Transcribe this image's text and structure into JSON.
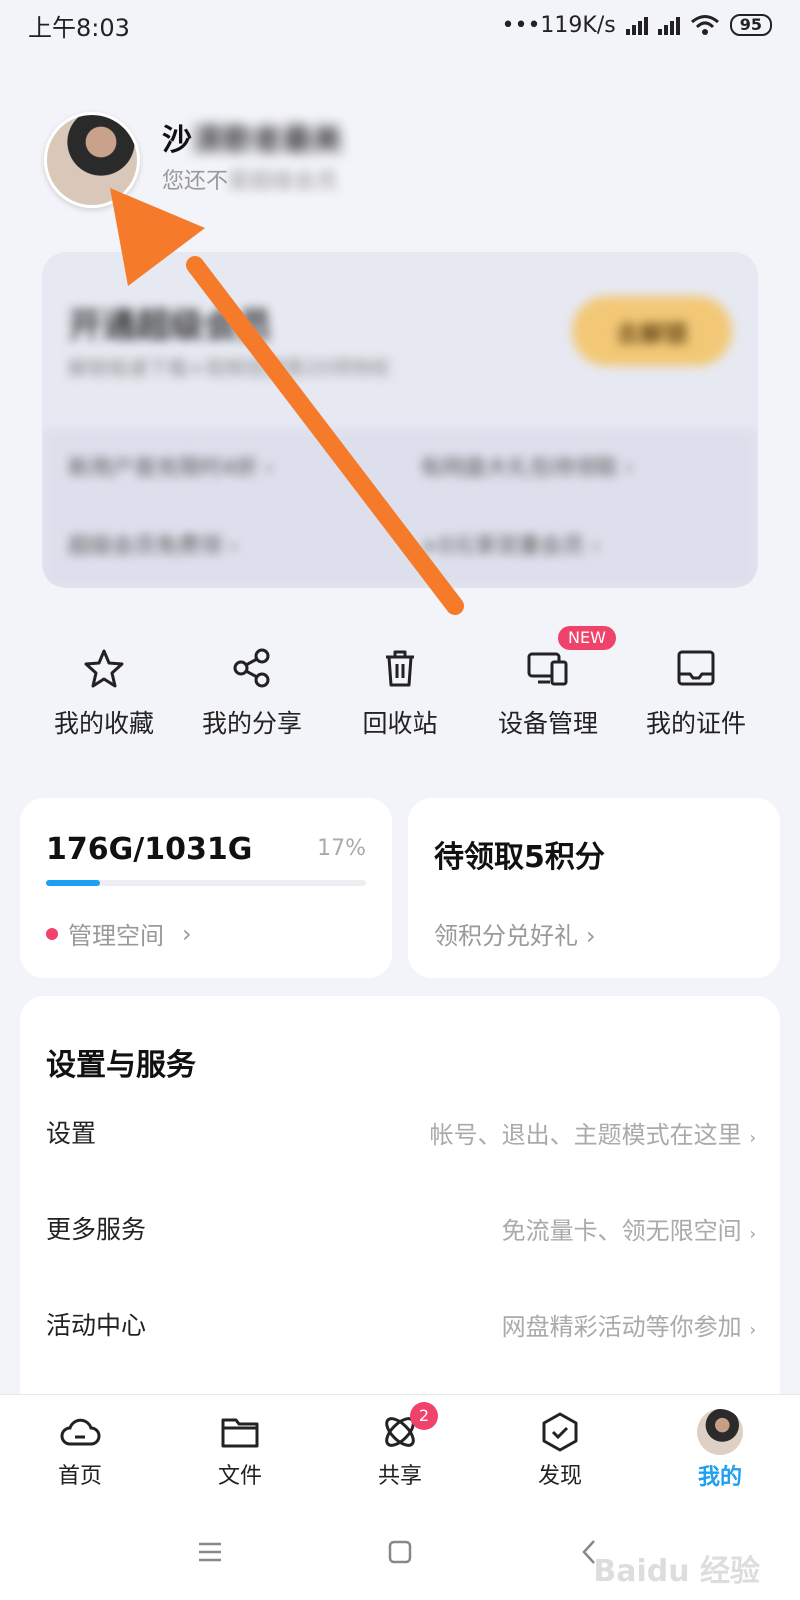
{
  "status": {
    "time": "上午8:03",
    "speed": "•••119K/s",
    "battery": "95"
  },
  "profile": {
    "name_visible": "沙",
    "name_hidden": "漠歌者最美",
    "sub_visible": "您还不",
    "sub_hidden": "是超级会员"
  },
  "vip": {
    "title": "开通超级会员",
    "desc": "解锁极速下载+视频倍速等20项特权",
    "button": "去解锁",
    "links": [
      "新用户首充限时4折 ›",
      "有网盘大礼包待领取 ›",
      "超级会员免费领 ›",
      "+0元享双重会员 ›"
    ]
  },
  "quick_actions": [
    {
      "label": "我的收藏",
      "icon": "star-icon"
    },
    {
      "label": "我的分享",
      "icon": "share-icon"
    },
    {
      "label": "回收站",
      "icon": "trash-icon"
    },
    {
      "label": "设备管理",
      "icon": "devices-icon",
      "badge": "NEW"
    },
    {
      "label": "我的证件",
      "icon": "id-card-icon"
    }
  ],
  "storage": {
    "amount": "176G/1031G",
    "percent": "17%",
    "fill": 0.17,
    "manage": "管理空间"
  },
  "points": {
    "title": "待领取5积分",
    "link": "领积分兑好礼"
  },
  "settings": {
    "title": "设置与服务",
    "rows": [
      {
        "label": "设置",
        "hint": "帐号、退出、主题模式在这里"
      },
      {
        "label": "更多服务",
        "hint": "免流量卡、领无限空间"
      },
      {
        "label": "活动中心",
        "hint": "网盘精彩活动等你参加"
      }
    ]
  },
  "nav": {
    "items": [
      {
        "label": "首页",
        "icon": "cloud-icon"
      },
      {
        "label": "文件",
        "icon": "folder-icon"
      },
      {
        "label": "共享",
        "icon": "share-orbit-icon",
        "badge": "2"
      },
      {
        "label": "发现",
        "icon": "discover-icon"
      },
      {
        "label": "我的",
        "icon": "avatar",
        "active": true
      }
    ]
  },
  "colors": {
    "accent": "#1ea0f0",
    "badge": "#f0436b",
    "arrow": "#f57a2a"
  }
}
